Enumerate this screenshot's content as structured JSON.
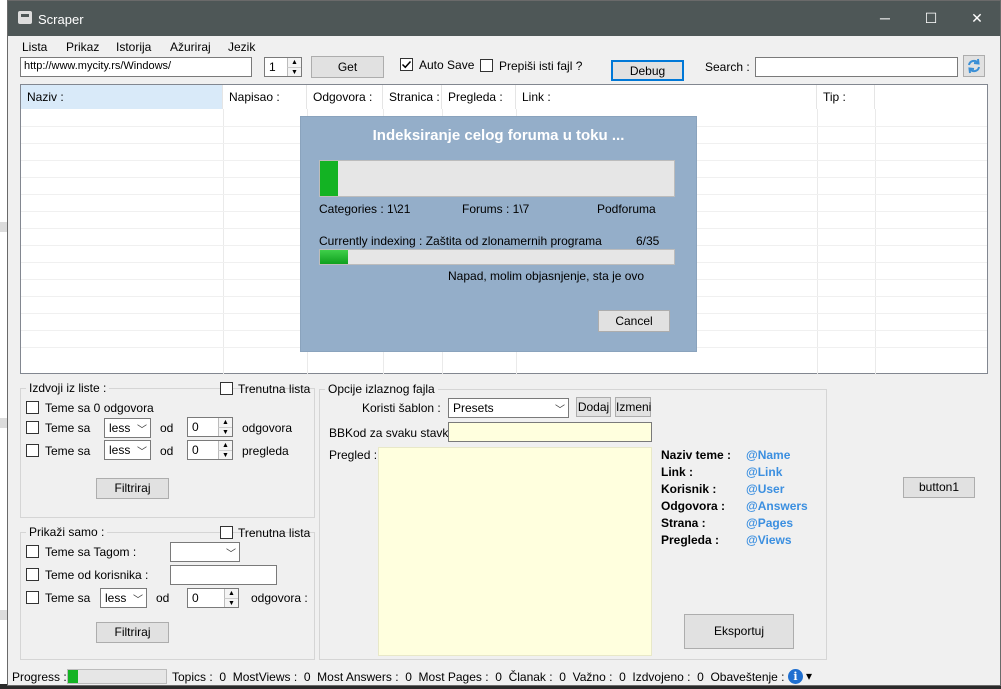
{
  "window": {
    "title": "Scraper",
    "min_label": "─",
    "max_label": "☐",
    "close_label": "✕"
  },
  "menu": [
    "Lista",
    "Prikaz",
    "Istorija",
    "Ažuriraj",
    "Jezik"
  ],
  "toolbar": {
    "url": "http://www.mycity.rs/Windows/",
    "page_number": "1",
    "get_label": "Get",
    "auto_save_label": "Auto Save",
    "auto_save_checked": true,
    "overwrite_label": "Prepiši isti fajl ?",
    "debug_label": "Debug",
    "search_label": "Search :",
    "search_value": ""
  },
  "grid": {
    "columns": [
      "Naziv :",
      "Napisao :",
      "Odgovora :",
      "Stranica :",
      "Pregleda :",
      "Link :",
      "Tip :"
    ]
  },
  "progress_dialog": {
    "title": "Indeksiranje celog foruma u toku ...",
    "overall_progress": 0.05,
    "categories_label": "Categories : 1\\21",
    "forums_label": "Forums : 1\\7",
    "subforum_label": "Podforuma",
    "current_label": "Currently indexing : Zaštita od zlonamernih programa",
    "current_count": "6/35",
    "current_progress": 0.08,
    "current_topic": "Napad, molim objasnjenje, sta je ovo",
    "cancel_label": "Cancel"
  },
  "extract_group": {
    "title": "Izdvoji iz liste :",
    "current_list_label": "Trenutna lista",
    "zero_answers_label": "Teme sa 0 odgovora",
    "row1": {
      "prefix": "Teme sa",
      "op": "less",
      "od": "od",
      "value": "0",
      "suffix": "odgovora"
    },
    "row2": {
      "prefix": "Teme sa",
      "op": "less",
      "od": "od",
      "value": "0",
      "suffix": "pregleda"
    },
    "filter_label": "Filtriraj"
  },
  "show_group": {
    "title": "Prikaži samo :",
    "current_list_label": "Trenutna lista",
    "tag_label": "Teme sa Tagom :",
    "user_label": "Teme od korisnika :",
    "row": {
      "prefix": "Teme sa",
      "op": "less",
      "od": "od",
      "value": "0",
      "suffix": "odgovora :"
    },
    "filter_label": "Filtriraj"
  },
  "output_group": {
    "title": "Opcije izlaznog fajla",
    "template_label": "Koristi šablon :",
    "template_value": "Presets",
    "add_label": "Dodaj",
    "edit_label": "Izmeni",
    "bbcode_label": "BBKod za svaku stavku :",
    "preview_label": "Pregled :",
    "tags": [
      {
        "name": "Naziv teme :",
        "value": "@Name"
      },
      {
        "name": "Link :",
        "value": "@Link"
      },
      {
        "name": "Korisnik :",
        "value": "@User"
      },
      {
        "name": "Odgovora :",
        "value": "@Answers"
      },
      {
        "name": "Strana :",
        "value": "@Pages"
      },
      {
        "name": "Pregleda :",
        "value": "@Views"
      }
    ],
    "export_label": "Eksportuj"
  },
  "button1_label": "button1",
  "status": {
    "progress_label": "Progress :",
    "progress": 0.1,
    "text": "Topics :  0  MostViews :  0  Most Answers :  0  Most Pages :  0  Članak :  0  Važno :  0  Izdvojeno :  0  Obaveštenje :  0",
    "info_icon": "i",
    "dropdown": "▾"
  },
  "colors": {
    "titlebar": "#4e5757",
    "dialog": "#94aec9",
    "progress": "#13b323",
    "tag_value": "#3b8fe0",
    "preview_bg": "#ffffde"
  }
}
